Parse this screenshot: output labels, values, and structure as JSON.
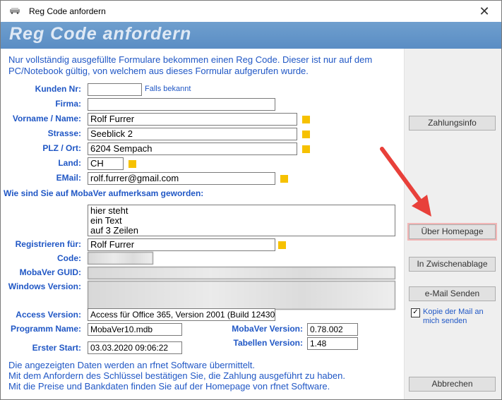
{
  "window": {
    "title": "Reg Code anfordern",
    "close_glyph": "✕"
  },
  "header": {
    "title": "Reg Code anfordern"
  },
  "intro": "Nur vollständig ausgefüllte Formulare bekommen einen Reg Code. Dieser ist nur auf dem PC/Notebook gültig, von welchem aus dieses Formular aufgerufen wurde.",
  "fields": {
    "kunden_nr": {
      "label": "Kunden Nr:",
      "value": "",
      "hint": "Falls bekannt"
    },
    "firma": {
      "label": "Firma:",
      "value": ""
    },
    "name": {
      "label": "Vorname / Name:",
      "value": "Rolf Furrer"
    },
    "strasse": {
      "label": "Strasse:",
      "value": "Seeblick 2"
    },
    "plz_ort": {
      "label": "PLZ / Ort:",
      "value": "6204 Sempach"
    },
    "land": {
      "label": "Land:",
      "value": "CH"
    },
    "email": {
      "label": "EMail:",
      "value": "rolf.furrer@gmail.com"
    },
    "aufmerksam": {
      "label": "Wie sind Sie auf MobaVer aufmerksam geworden:",
      "value": "hier steht\nein Text\nauf 3 Zeilen"
    },
    "registrieren": {
      "label": "Registrieren für:",
      "value": "Rolf Furrer"
    },
    "code": {
      "label": "Code:"
    },
    "guid": {
      "label": "MobaVer GUID:"
    },
    "windows_version": {
      "label": "Windows Version:"
    },
    "access_version": {
      "label": "Access Version:",
      "value": "Access für Office 365, Version 2001 (Build 12430"
    },
    "programm_name": {
      "label": "Programm Name:",
      "value": "MobaVer10.mdb"
    },
    "mobaver_version": {
      "label": "MobaVer Version:",
      "value": "0.78.002"
    },
    "tabellen_version": {
      "label": "Tabellen Version:",
      "value": "1.48"
    },
    "erster_start": {
      "label": "Erster Start:",
      "value": "03.03.2020 09:06:22"
    }
  },
  "footer": "Die  angezeigten Daten werden an rfnet Software übermittelt.\nMit dem Anfordern des Schlüssel bestätigen Sie, die Zahlung ausgeführt zu haben.\nMit die Preise und Bankdaten finden Sie auf der Homepage von rfnet Software.",
  "side": {
    "zahlungsinfo": "Zahlungsinfo",
    "homepage": "Über Homepage",
    "zwischenablage": "In Zwischenablage",
    "email_senden": "e-Mail Senden",
    "kopie_label": "Kopie der Mail an mich senden",
    "kopie_checked": true,
    "abbrechen": "Abbrechen"
  },
  "colors": {
    "label_blue": "#2057c5",
    "required_marker": "#f6c100",
    "header_blue": "#5a8dc4",
    "arrow_red": "#e8403a"
  }
}
